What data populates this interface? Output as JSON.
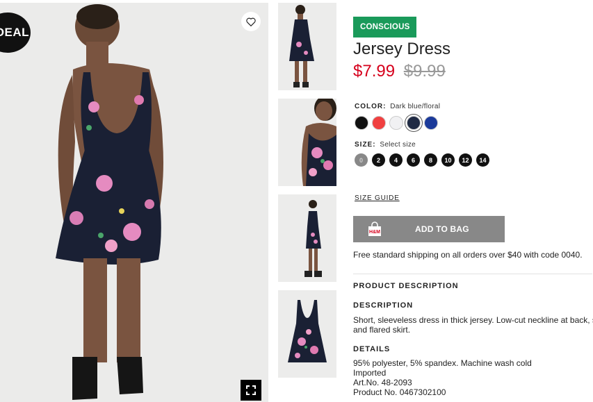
{
  "main_image": {
    "deal_badge": "DEAL",
    "favorite_icon": "heart-icon",
    "fullscreen_icon": "fullscreen-icon"
  },
  "thumbnails": [
    {
      "view": "back"
    },
    {
      "view": "front-closeup"
    },
    {
      "view": "side"
    },
    {
      "view": "flat"
    }
  ],
  "product": {
    "badge": "CONSCIOUS",
    "title": "Jersey Dress",
    "price_sale": "$7.99",
    "price_original": "$9.99",
    "color_label": "COLOR:",
    "color_value": "Dark blue/floral",
    "colors": [
      {
        "name": "black",
        "hex": "#111111"
      },
      {
        "name": "red",
        "hex": "#f04040"
      },
      {
        "name": "white",
        "hex": "#f1f1f3"
      },
      {
        "name": "dark-blue-floral",
        "hex": "#1f2a44",
        "selected": true
      },
      {
        "name": "blue",
        "hex": "#1b3a9a"
      }
    ],
    "size_label": "SIZE:",
    "size_value": "Select size",
    "sizes": [
      "0",
      "2",
      "4",
      "6",
      "8",
      "10",
      "12",
      "14"
    ],
    "size_guide": "SIZE GUIDE",
    "add_to_bag": "ADD TO BAG",
    "shipping": "Free standard shipping on all orders over $40 with code 0040.",
    "product_description_heading": "PRODUCT DESCRIPTION",
    "description_heading": "DESCRIPTION",
    "description_line1": "Short, sleeveless dress in thick jersey. Low-cut neckline at back, s",
    "description_line2": "and flared skirt.",
    "details_heading": "DETAILS",
    "details": [
      "95% polyester, 5% spandex. Machine wash cold",
      "Imported",
      "Art.No. 48-2093",
      "Product No. 0467302100"
    ]
  },
  "colors": {
    "conscious_green": "#1a9a5a",
    "sale_red": "#d6001c",
    "button_gray": "#888888"
  }
}
